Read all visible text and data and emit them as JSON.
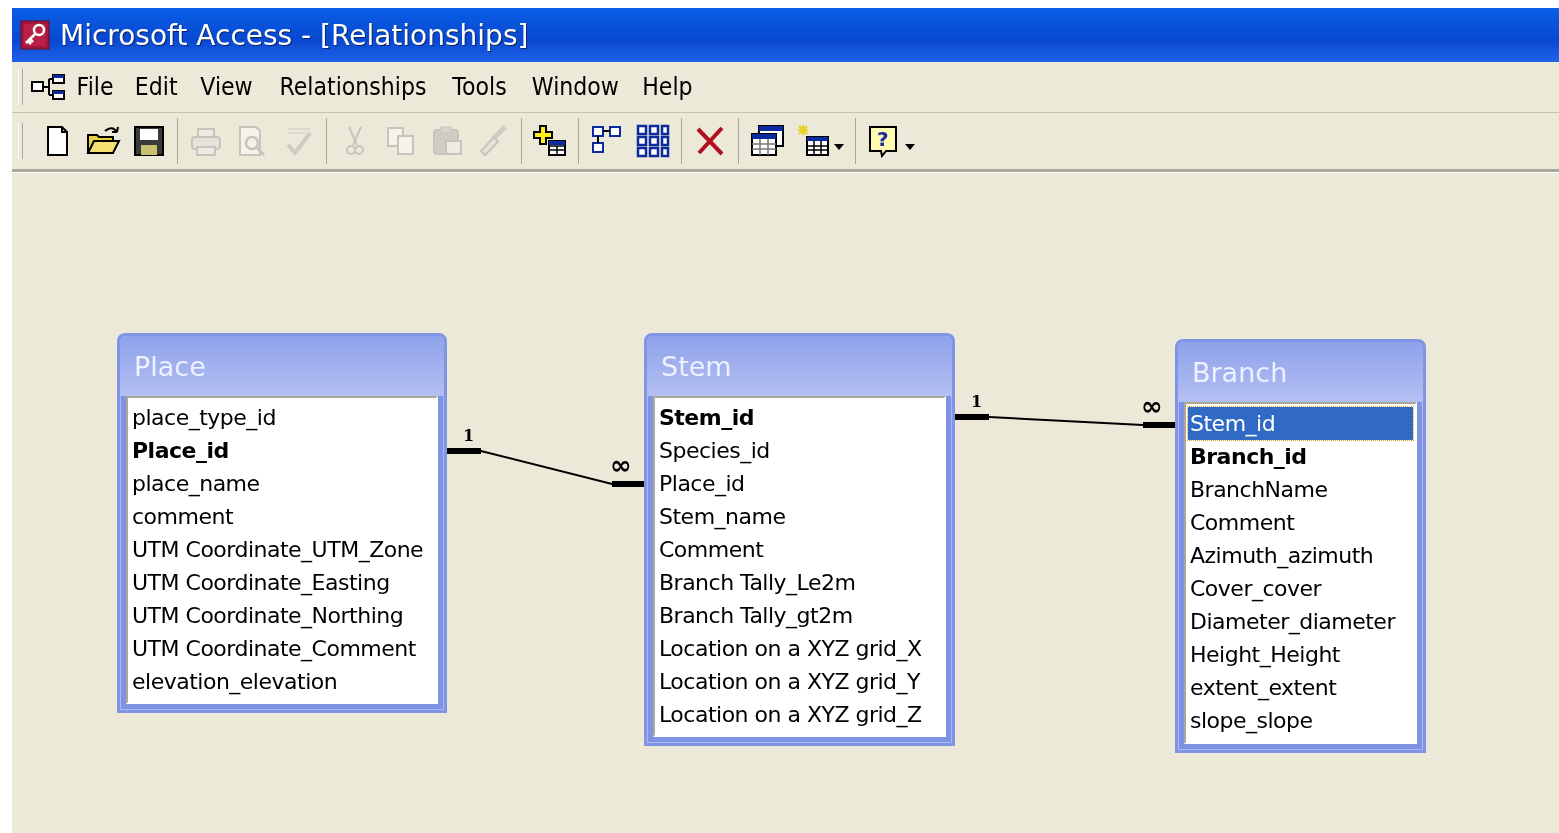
{
  "window": {
    "title": "Microsoft Access - [Relationships]"
  },
  "menu": [
    {
      "label": "File"
    },
    {
      "label": "Edit"
    },
    {
      "label": "View"
    },
    {
      "label": "Relationships"
    },
    {
      "label": "Tools"
    },
    {
      "label": "Window"
    },
    {
      "label": "Help"
    }
  ],
  "toolbar": [
    [
      {
        "kind": "new",
        "disabled": false
      },
      {
        "kind": "open",
        "disabled": false
      },
      {
        "kind": "save",
        "disabled": false
      }
    ],
    [
      {
        "kind": "print",
        "disabled": true
      },
      {
        "kind": "preview",
        "disabled": true
      },
      {
        "kind": "spelling",
        "disabled": true
      }
    ],
    [
      {
        "kind": "cut",
        "disabled": true
      },
      {
        "kind": "copy",
        "disabled": true
      },
      {
        "kind": "paste",
        "disabled": true
      },
      {
        "kind": "painter",
        "disabled": true
      }
    ],
    [
      {
        "kind": "show-table",
        "disabled": false
      }
    ],
    [
      {
        "kind": "direct",
        "disabled": false
      },
      {
        "kind": "all",
        "disabled": false
      }
    ],
    [
      {
        "kind": "delete",
        "disabled": false
      }
    ],
    [
      {
        "kind": "dbwindow",
        "disabled": false
      },
      {
        "kind": "newobject",
        "disabled": false,
        "dropdown": true
      }
    ],
    [
      {
        "kind": "help",
        "disabled": false,
        "dropdown": true,
        "glyph": "?"
      }
    ]
  ],
  "tables": [
    {
      "title": "Place",
      "fields": [
        {
          "name": "place_type_id",
          "key": false,
          "selected": false
        },
        {
          "name": "Place_id",
          "key": true,
          "selected": false
        },
        {
          "name": "place_name",
          "key": false,
          "selected": false
        },
        {
          "name": "comment",
          "key": false,
          "selected": false
        },
        {
          "name": "UTM Coordinate_UTM_Zone",
          "key": false,
          "selected": false
        },
        {
          "name": "UTM Coordinate_Easting",
          "key": false,
          "selected": false
        },
        {
          "name": "UTM Coordinate_Northing",
          "key": false,
          "selected": false
        },
        {
          "name": "UTM Coordinate_Comment",
          "key": false,
          "selected": false
        },
        {
          "name": "elevation_elevation",
          "key": false,
          "selected": false
        }
      ]
    },
    {
      "title": "Stem",
      "fields": [
        {
          "name": "Stem_id",
          "key": true,
          "selected": false
        },
        {
          "name": "Species_id",
          "key": false,
          "selected": false
        },
        {
          "name": "Place_id",
          "key": false,
          "selected": false
        },
        {
          "name": "Stem_name",
          "key": false,
          "selected": false
        },
        {
          "name": "Comment",
          "key": false,
          "selected": false
        },
        {
          "name": "Branch Tally_Le2m",
          "key": false,
          "selected": false
        },
        {
          "name": "Branch Tally_gt2m",
          "key": false,
          "selected": false
        },
        {
          "name": "Location on a XYZ grid_X",
          "key": false,
          "selected": false
        },
        {
          "name": "Location on a XYZ grid_Y",
          "key": false,
          "selected": false
        },
        {
          "name": "Location on a XYZ grid_Z",
          "key": false,
          "selected": false
        }
      ]
    },
    {
      "title": "Branch",
      "fields": [
        {
          "name": "Stem_id",
          "key": false,
          "selected": true
        },
        {
          "name": "Branch_id",
          "key": true,
          "selected": false
        },
        {
          "name": "BranchName",
          "key": false,
          "selected": false
        },
        {
          "name": "Comment",
          "key": false,
          "selected": false
        },
        {
          "name": "Azimuth_azimuth",
          "key": false,
          "selected": false
        },
        {
          "name": "Cover_cover",
          "key": false,
          "selected": false
        },
        {
          "name": "Diameter_diameter",
          "key": false,
          "selected": false
        },
        {
          "name": "Height_Height",
          "key": false,
          "selected": false
        },
        {
          "name": "extent_extent",
          "key": false,
          "selected": false
        },
        {
          "name": "slope_slope",
          "key": false,
          "selected": false
        }
      ]
    }
  ],
  "relationships": [
    {
      "one": "1",
      "many": "∞"
    },
    {
      "one": "1",
      "many": "∞"
    }
  ]
}
